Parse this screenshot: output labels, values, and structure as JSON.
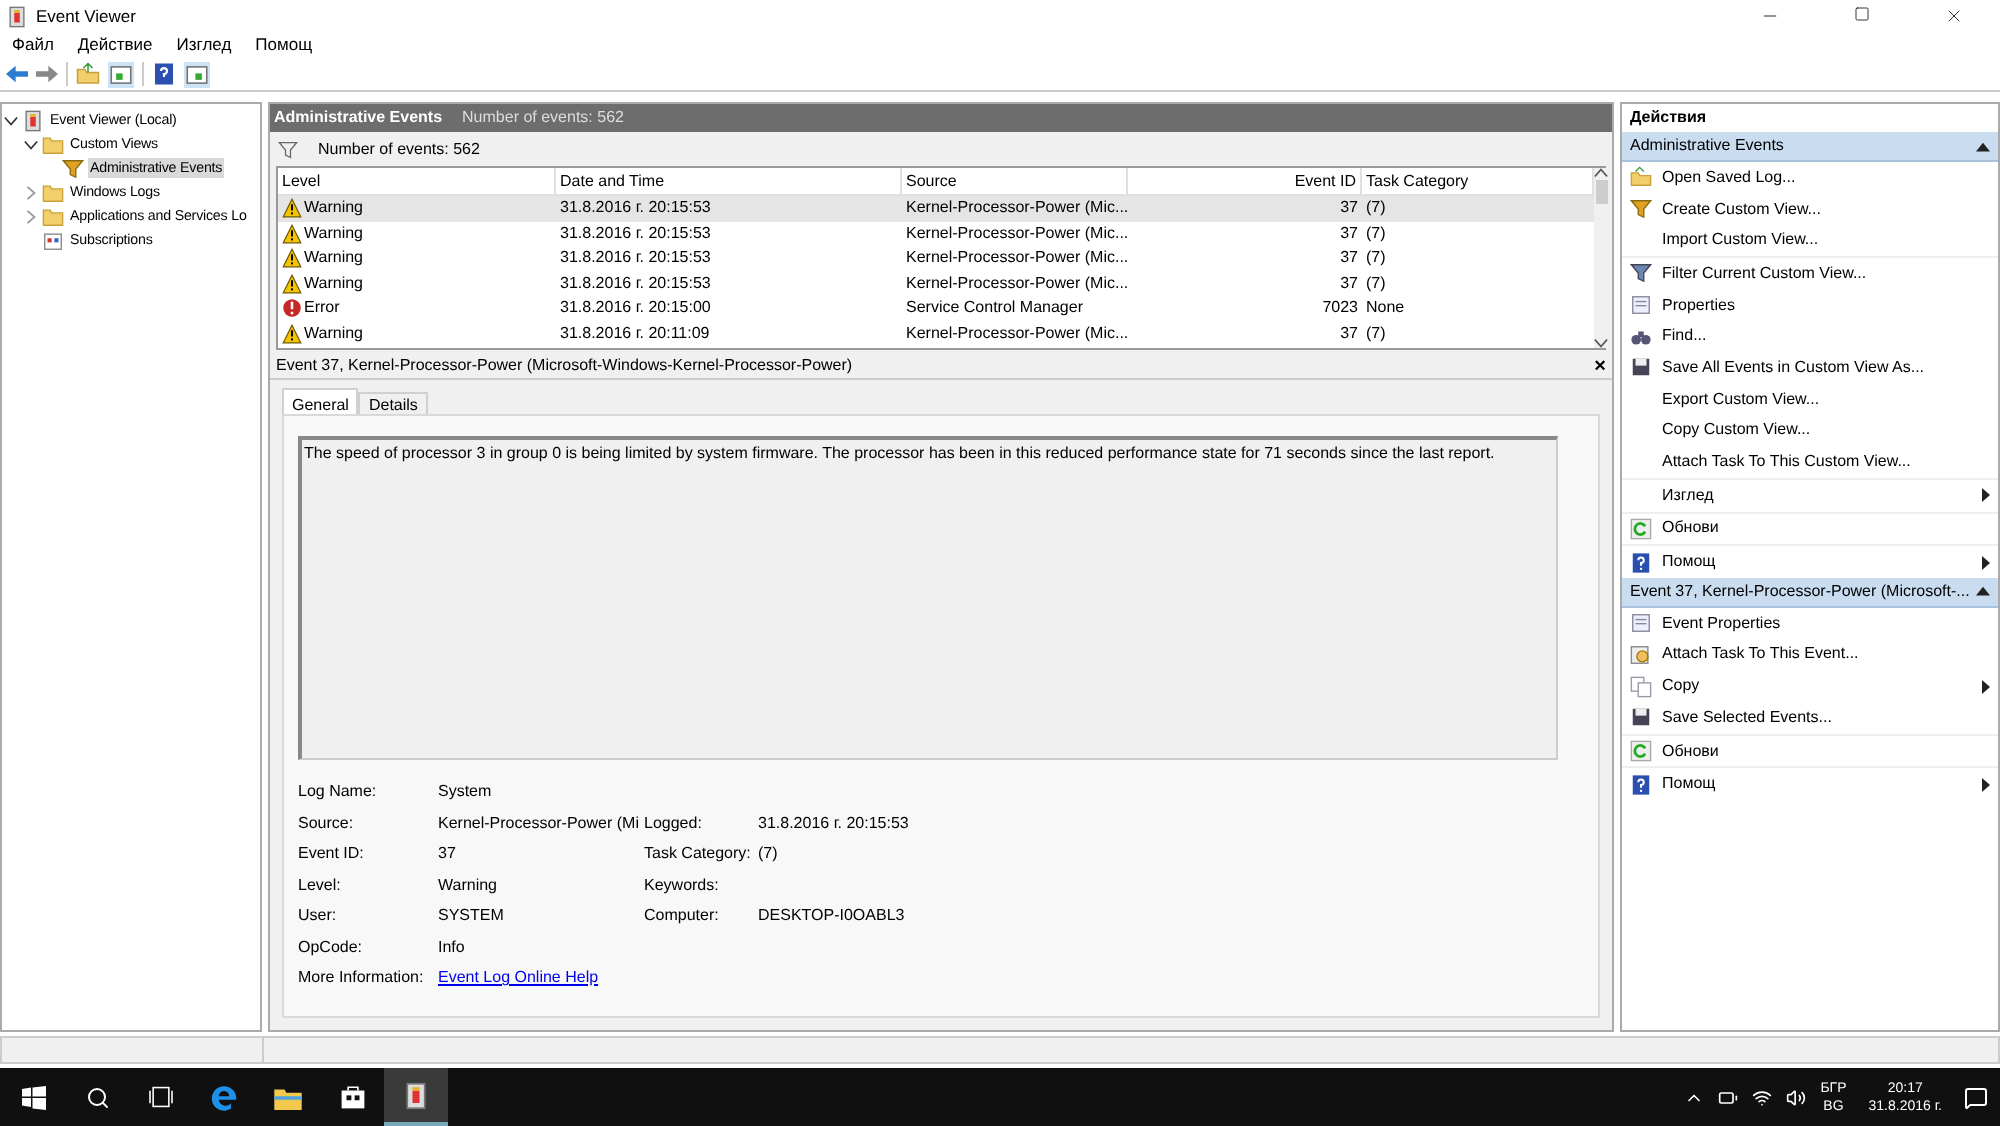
{
  "window": {
    "title": "Event Viewer"
  },
  "menu": [
    "Файл",
    "Действие",
    "Изглед",
    "Помощ"
  ],
  "tree": [
    {
      "label": "Event Viewer (Local)",
      "kind": "viewer",
      "expanded": true,
      "selected": false,
      "children": [
        {
          "label": "Custom Views",
          "kind": "folder",
          "expanded": true,
          "selected": false,
          "children": [
            {
              "label": "Administrative Events",
              "kind": "filter",
              "selected": true
            }
          ]
        },
        {
          "label": "Windows Logs",
          "kind": "folder",
          "expanded": false,
          "selected": false
        },
        {
          "label": "Applications and Services Lo",
          "kind": "folder",
          "expanded": false,
          "selected": false
        },
        {
          "label": "Subscriptions",
          "kind": "subs",
          "selected": false
        }
      ]
    }
  ],
  "center": {
    "title": "Administrative Events",
    "count": "Number of events: 562",
    "filter_count": "Number of events: 562",
    "columns": [
      "Level",
      "Date and Time",
      "Source",
      "Event ID",
      "Task Category"
    ],
    "rows": [
      {
        "kind": "warning",
        "level": "Warning",
        "date": "31.8.2016 г. 20:15:53",
        "source": "Kernel-Processor-Power (Mic...",
        "id": "37",
        "category": "(7)",
        "selected": true
      },
      {
        "kind": "warning",
        "level": "Warning",
        "date": "31.8.2016 г. 20:15:53",
        "source": "Kernel-Processor-Power (Mic...",
        "id": "37",
        "category": "(7)",
        "selected": false
      },
      {
        "kind": "warning",
        "level": "Warning",
        "date": "31.8.2016 г. 20:15:53",
        "source": "Kernel-Processor-Power (Mic...",
        "id": "37",
        "category": "(7)",
        "selected": false
      },
      {
        "kind": "warning",
        "level": "Warning",
        "date": "31.8.2016 г. 20:15:53",
        "source": "Kernel-Processor-Power (Mic...",
        "id": "37",
        "category": "(7)",
        "selected": false
      },
      {
        "kind": "error",
        "level": "Error",
        "date": "31.8.2016 г. 20:15:00",
        "source": "Service Control Manager",
        "id": "7023",
        "category": "None",
        "selected": false
      },
      {
        "kind": "warning",
        "level": "Warning",
        "date": "31.8.2016 г. 20:11:09",
        "source": "Kernel-Processor-Power (Mic...",
        "id": "37",
        "category": "(7)",
        "selected": false
      }
    ]
  },
  "detail": {
    "title": "Event 37, Kernel-Processor-Power (Microsoft-Windows-Kernel-Processor-Power)",
    "close": "×",
    "tabs": [
      {
        "label": "General",
        "selected": true
      },
      {
        "label": "Details",
        "selected": false
      }
    ],
    "description": "The speed of processor 3 in group 0 is being limited by system firmware. The processor has been in this reduced performance state for 71 seconds since the last report.",
    "fields": [
      {
        "label": "Log Name:",
        "value": "System"
      },
      {
        "label": "Source:",
        "value": "Kernel-Processor-Power (Mi",
        "label2": "Logged:",
        "value2": "31.8.2016 г. 20:15:53"
      },
      {
        "label": "Event ID:",
        "value": "37",
        "label2": "Task Category:",
        "value2": "(7)"
      },
      {
        "label": "Level:",
        "value": "Warning",
        "label2": "Keywords:"
      },
      {
        "label": "User:",
        "value": "SYSTEM",
        "label2": "Computer:",
        "value2": "DESKTOP-I0OABL3"
      },
      {
        "label": "OpCode:",
        "value": "Info"
      }
    ],
    "more_info_label": "More Information:",
    "more_info_link": "Event Log Online Help"
  },
  "actions": {
    "title": "Действия",
    "sections": [
      {
        "title": "Administrative Events",
        "expanded": true,
        "groups": [
          [
            {
              "label": "Open Saved Log...",
              "kind": "open"
            },
            {
              "label": "Create Custom View...",
              "kind": "filter"
            },
            {
              "label": "Import Custom View...",
              "kind": "plain"
            }
          ],
          [
            {
              "label": "Filter Current Custom View...",
              "kind": "filter2"
            },
            {
              "label": "Properties",
              "kind": "props"
            },
            {
              "label": "Find...",
              "kind": "find"
            },
            {
              "label": "Save All Events in Custom View As...",
              "kind": "save"
            },
            {
              "label": "Export Custom View...",
              "kind": "plain"
            },
            {
              "label": "Copy Custom View...",
              "kind": "plain"
            },
            {
              "label": "Attach Task To This Custom View...",
              "kind": "plain"
            }
          ],
          [
            {
              "label": "Изглед",
              "kind": "plain",
              "submenu": true
            }
          ],
          [
            {
              "label": "Обнови",
              "kind": "refresh"
            }
          ],
          [
            {
              "label": "Помощ",
              "kind": "help",
              "submenu": true
            }
          ]
        ]
      },
      {
        "title": "Event 37, Kernel-Processor-Power (Microsoft-...",
        "expanded": true,
        "groups": [
          [
            {
              "label": "Event Properties",
              "kind": "props"
            },
            {
              "label": "Attach Task To This Event...",
              "kind": "task"
            },
            {
              "label": "Copy",
              "kind": "copy",
              "submenu": true
            },
            {
              "label": "Save Selected Events...",
              "kind": "save"
            }
          ],
          [
            {
              "label": "Обнови",
              "kind": "refresh"
            }
          ],
          [
            {
              "label": "Помощ",
              "kind": "help",
              "submenu": true
            }
          ]
        ]
      }
    ]
  },
  "taskbar": {
    "lang_top": "БГР",
    "lang_bottom": "BG",
    "time": "20:17",
    "date": "31.8.2016 г."
  }
}
